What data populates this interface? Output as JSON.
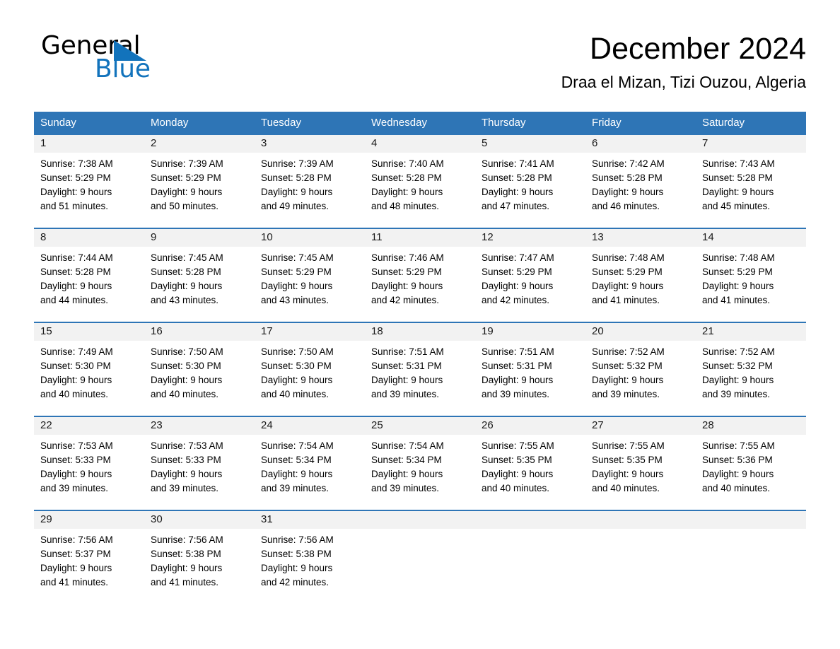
{
  "brand": {
    "name_part1": "General",
    "name_part2": "Blue",
    "triangle_icon": "triangle-icon",
    "accent_color": "#1273BC"
  },
  "header": {
    "title": "December 2024",
    "subtitle": "Draa el Mizan, Tizi Ouzou, Algeria"
  },
  "theme": {
    "header_blue": "#2E75B6",
    "daynum_band": "#F2F2F2",
    "text": "#000000"
  },
  "weekdays": [
    "Sunday",
    "Monday",
    "Tuesday",
    "Wednesday",
    "Thursday",
    "Friday",
    "Saturday"
  ],
  "weeks": [
    [
      {
        "day": "1",
        "sunrise": "Sunrise: 7:38 AM",
        "sunset": "Sunset: 5:29 PM",
        "daylight_1": "Daylight: 9 hours",
        "daylight_2": "and 51 minutes."
      },
      {
        "day": "2",
        "sunrise": "Sunrise: 7:39 AM",
        "sunset": "Sunset: 5:29 PM",
        "daylight_1": "Daylight: 9 hours",
        "daylight_2": "and 50 minutes."
      },
      {
        "day": "3",
        "sunrise": "Sunrise: 7:39 AM",
        "sunset": "Sunset: 5:28 PM",
        "daylight_1": "Daylight: 9 hours",
        "daylight_2": "and 49 minutes."
      },
      {
        "day": "4",
        "sunrise": "Sunrise: 7:40 AM",
        "sunset": "Sunset: 5:28 PM",
        "daylight_1": "Daylight: 9 hours",
        "daylight_2": "and 48 minutes."
      },
      {
        "day": "5",
        "sunrise": "Sunrise: 7:41 AM",
        "sunset": "Sunset: 5:28 PM",
        "daylight_1": "Daylight: 9 hours",
        "daylight_2": "and 47 minutes."
      },
      {
        "day": "6",
        "sunrise": "Sunrise: 7:42 AM",
        "sunset": "Sunset: 5:28 PM",
        "daylight_1": "Daylight: 9 hours",
        "daylight_2": "and 46 minutes."
      },
      {
        "day": "7",
        "sunrise": "Sunrise: 7:43 AM",
        "sunset": "Sunset: 5:28 PM",
        "daylight_1": "Daylight: 9 hours",
        "daylight_2": "and 45 minutes."
      }
    ],
    [
      {
        "day": "8",
        "sunrise": "Sunrise: 7:44 AM",
        "sunset": "Sunset: 5:28 PM",
        "daylight_1": "Daylight: 9 hours",
        "daylight_2": "and 44 minutes."
      },
      {
        "day": "9",
        "sunrise": "Sunrise: 7:45 AM",
        "sunset": "Sunset: 5:28 PM",
        "daylight_1": "Daylight: 9 hours",
        "daylight_2": "and 43 minutes."
      },
      {
        "day": "10",
        "sunrise": "Sunrise: 7:45 AM",
        "sunset": "Sunset: 5:29 PM",
        "daylight_1": "Daylight: 9 hours",
        "daylight_2": "and 43 minutes."
      },
      {
        "day": "11",
        "sunrise": "Sunrise: 7:46 AM",
        "sunset": "Sunset: 5:29 PM",
        "daylight_1": "Daylight: 9 hours",
        "daylight_2": "and 42 minutes."
      },
      {
        "day": "12",
        "sunrise": "Sunrise: 7:47 AM",
        "sunset": "Sunset: 5:29 PM",
        "daylight_1": "Daylight: 9 hours",
        "daylight_2": "and 42 minutes."
      },
      {
        "day": "13",
        "sunrise": "Sunrise: 7:48 AM",
        "sunset": "Sunset: 5:29 PM",
        "daylight_1": "Daylight: 9 hours",
        "daylight_2": "and 41 minutes."
      },
      {
        "day": "14",
        "sunrise": "Sunrise: 7:48 AM",
        "sunset": "Sunset: 5:29 PM",
        "daylight_1": "Daylight: 9 hours",
        "daylight_2": "and 41 minutes."
      }
    ],
    [
      {
        "day": "15",
        "sunrise": "Sunrise: 7:49 AM",
        "sunset": "Sunset: 5:30 PM",
        "daylight_1": "Daylight: 9 hours",
        "daylight_2": "and 40 minutes."
      },
      {
        "day": "16",
        "sunrise": "Sunrise: 7:50 AM",
        "sunset": "Sunset: 5:30 PM",
        "daylight_1": "Daylight: 9 hours",
        "daylight_2": "and 40 minutes."
      },
      {
        "day": "17",
        "sunrise": "Sunrise: 7:50 AM",
        "sunset": "Sunset: 5:30 PM",
        "daylight_1": "Daylight: 9 hours",
        "daylight_2": "and 40 minutes."
      },
      {
        "day": "18",
        "sunrise": "Sunrise: 7:51 AM",
        "sunset": "Sunset: 5:31 PM",
        "daylight_1": "Daylight: 9 hours",
        "daylight_2": "and 39 minutes."
      },
      {
        "day": "19",
        "sunrise": "Sunrise: 7:51 AM",
        "sunset": "Sunset: 5:31 PM",
        "daylight_1": "Daylight: 9 hours",
        "daylight_2": "and 39 minutes."
      },
      {
        "day": "20",
        "sunrise": "Sunrise: 7:52 AM",
        "sunset": "Sunset: 5:32 PM",
        "daylight_1": "Daylight: 9 hours",
        "daylight_2": "and 39 minutes."
      },
      {
        "day": "21",
        "sunrise": "Sunrise: 7:52 AM",
        "sunset": "Sunset: 5:32 PM",
        "daylight_1": "Daylight: 9 hours",
        "daylight_2": "and 39 minutes."
      }
    ],
    [
      {
        "day": "22",
        "sunrise": "Sunrise: 7:53 AM",
        "sunset": "Sunset: 5:33 PM",
        "daylight_1": "Daylight: 9 hours",
        "daylight_2": "and 39 minutes."
      },
      {
        "day": "23",
        "sunrise": "Sunrise: 7:53 AM",
        "sunset": "Sunset: 5:33 PM",
        "daylight_1": "Daylight: 9 hours",
        "daylight_2": "and 39 minutes."
      },
      {
        "day": "24",
        "sunrise": "Sunrise: 7:54 AM",
        "sunset": "Sunset: 5:34 PM",
        "daylight_1": "Daylight: 9 hours",
        "daylight_2": "and 39 minutes."
      },
      {
        "day": "25",
        "sunrise": "Sunrise: 7:54 AM",
        "sunset": "Sunset: 5:34 PM",
        "daylight_1": "Daylight: 9 hours",
        "daylight_2": "and 39 minutes."
      },
      {
        "day": "26",
        "sunrise": "Sunrise: 7:55 AM",
        "sunset": "Sunset: 5:35 PM",
        "daylight_1": "Daylight: 9 hours",
        "daylight_2": "and 40 minutes."
      },
      {
        "day": "27",
        "sunrise": "Sunrise: 7:55 AM",
        "sunset": "Sunset: 5:35 PM",
        "daylight_1": "Daylight: 9 hours",
        "daylight_2": "and 40 minutes."
      },
      {
        "day": "28",
        "sunrise": "Sunrise: 7:55 AM",
        "sunset": "Sunset: 5:36 PM",
        "daylight_1": "Daylight: 9 hours",
        "daylight_2": "and 40 minutes."
      }
    ],
    [
      {
        "day": "29",
        "sunrise": "Sunrise: 7:56 AM",
        "sunset": "Sunset: 5:37 PM",
        "daylight_1": "Daylight: 9 hours",
        "daylight_2": "and 41 minutes."
      },
      {
        "day": "30",
        "sunrise": "Sunrise: 7:56 AM",
        "sunset": "Sunset: 5:38 PM",
        "daylight_1": "Daylight: 9 hours",
        "daylight_2": "and 41 minutes."
      },
      {
        "day": "31",
        "sunrise": "Sunrise: 7:56 AM",
        "sunset": "Sunset: 5:38 PM",
        "daylight_1": "Daylight: 9 hours",
        "daylight_2": "and 42 minutes."
      },
      {
        "day": "",
        "sunrise": "",
        "sunset": "",
        "daylight_1": "",
        "daylight_2": ""
      },
      {
        "day": "",
        "sunrise": "",
        "sunset": "",
        "daylight_1": "",
        "daylight_2": ""
      },
      {
        "day": "",
        "sunrise": "",
        "sunset": "",
        "daylight_1": "",
        "daylight_2": ""
      },
      {
        "day": "",
        "sunrise": "",
        "sunset": "",
        "daylight_1": "",
        "daylight_2": ""
      }
    ]
  ]
}
